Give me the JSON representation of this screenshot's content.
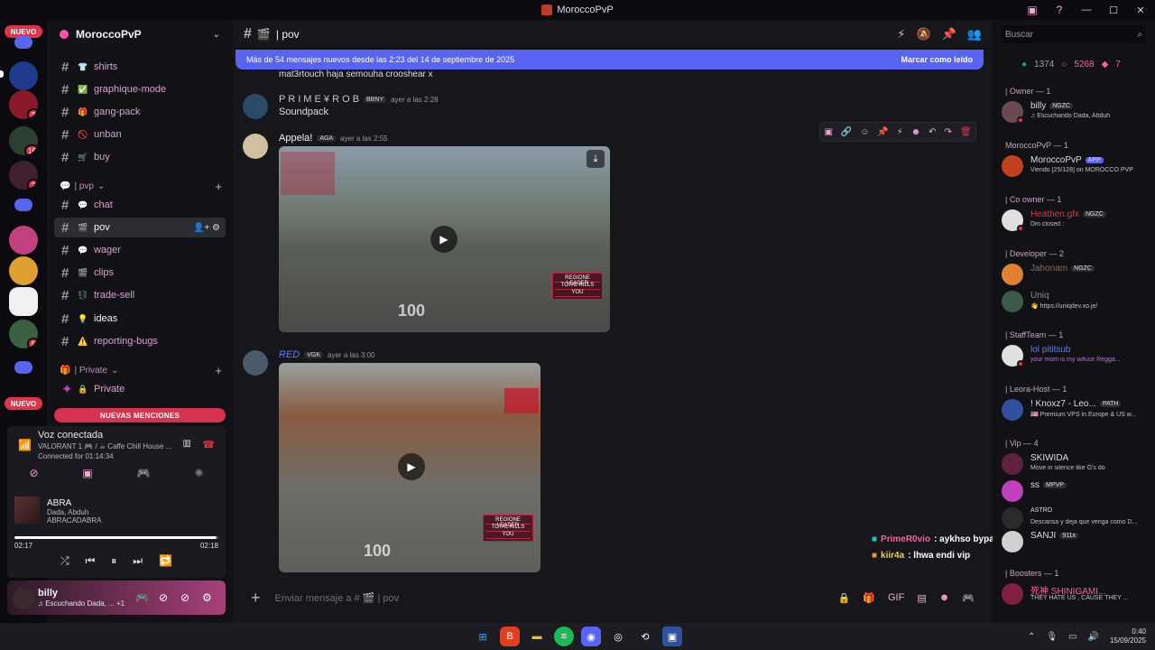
{
  "window": {
    "title": "MoroccoPvP"
  },
  "server": {
    "name": "MoroccoPvP"
  },
  "servers": {
    "new_label": "NUEVO",
    "badges": [
      "3",
      "16",
      "2",
      "5"
    ]
  },
  "channels": {
    "items": [
      {
        "emoji": "👕",
        "name": "shirts"
      },
      {
        "emoji": "✅",
        "name": "graphique-mode"
      },
      {
        "emoji": "🎁",
        "name": "gang-pack"
      },
      {
        "emoji": "🚫",
        "name": "unban"
      },
      {
        "emoji": "🛒",
        "name": "buy"
      }
    ],
    "cat_pvp": "| pvp",
    "pvp_items": [
      {
        "emoji": "💬",
        "name": "chat"
      },
      {
        "emoji": "🎬",
        "name": "pov"
      },
      {
        "emoji": "💬",
        "name": "wager"
      },
      {
        "emoji": "🎬",
        "name": "clips"
      },
      {
        "emoji": "💱",
        "name": "trade-sell"
      },
      {
        "emoji": "💡",
        "name": "ideas"
      },
      {
        "emoji": "⚠️",
        "name": "reporting-bugs"
      }
    ],
    "cat_private": "| Private",
    "private_item": {
      "emoji": "🔒",
      "name": "Private"
    },
    "new_mentions": "NUEVAS MENCIONES"
  },
  "voice": {
    "title": "Voz conectada",
    "sub": "VALORANT 1 🎮 / ☕ Caffe Chill House ...",
    "connected": "Connected for 01:14:34"
  },
  "song": {
    "title": "ABRA",
    "artist": "Dada, Abduh",
    "album": "ABRACADABRA",
    "elapsed": "02:17",
    "total": "02:18",
    "progress": 0.99
  },
  "user": {
    "name": "billy",
    "status": "♫ Escuchando Dada, ...",
    "extra": "+1"
  },
  "chat": {
    "channel_name": "pov",
    "new_banner": "Más de 54 mensajes nuevos desde las 2:23 del 14 de septiembre de 2025",
    "mark_read": "Marcar como leído",
    "prev_text": "mat3rtouch hajа semouha crooshear x",
    "messages": [
      {
        "name": "P R I M E ¥ R O B",
        "tag": "BBNY",
        "time": "ayer a las 2:28",
        "text": "Soundpack"
      },
      {
        "name": "Appela!",
        "tag": "AGA",
        "time": "ayer a las 2:55",
        "text": ""
      },
      {
        "name": "RED",
        "tag": "VGK",
        "time": "ayer a las 3:00",
        "text": ""
      }
    ],
    "overlay": [
      {
        "name": "PrimeR0vio",
        "text": ": aykhso bypass"
      },
      {
        "name": "kiir4a",
        "text": ": lhwa endi vip"
      }
    ],
    "placeholder": "Enviar mensaje a # 🎬 | pov",
    "hud": [
      "REGIONE LEADER",
      "TOTAL KILLS",
      "YOU"
    ],
    "hud_value": "100"
  },
  "members": {
    "search": "Buscar",
    "online": "1374",
    "members": "5268",
    "boost": "7",
    "groups": [
      {
        "cat": "| Owner — 1",
        "list": [
          {
            "name": "billy",
            "tag": "NGZC",
            "status": "♫ Escuchando Dada, Abduh",
            "color": "#ffffff"
          }
        ]
      },
      {
        "cat": "MoroccoPvP — 1",
        "list": [
          {
            "name": "MoroccoPvP",
            "tag": "APP",
            "status": "Viendo [25/128] on MOROCCO PVP",
            "color": "#ffffff"
          }
        ]
      },
      {
        "cat": "| Co owner — 1",
        "list": [
          {
            "name": "Heathen.gfx",
            "tag": "NGZC",
            "status": "Dm closed :",
            "color": "#e0344b"
          }
        ]
      },
      {
        "cat": "| Developer — 2",
        "list": [
          {
            "name": "Jahonam",
            "tag": "NGZC",
            "status": "",
            "color": "#8a6a5a"
          },
          {
            "name": "Uniq",
            "tag": "",
            "status": "👋 https://uniqdev.xo.je/",
            "color": "#7a8a9a"
          }
        ]
      },
      {
        "cat": "| StaffTeam — 1",
        "list": [
          {
            "name": "lol pititsub",
            "tag": "",
            "status": "your mom is my wifuce Regga...",
            "color": "#5b7cff"
          }
        ]
      },
      {
        "cat": "| Leora-Host — 1",
        "list": [
          {
            "name": "! Knoxz7 - Leo...",
            "tag": "PATH",
            "status": "🇺🇸 Premium VPS in Europe & US w...",
            "color": "#ffffff"
          }
        ]
      },
      {
        "cat": "| Vip — 4",
        "list": [
          {
            "name": "SKIWIDA",
            "tag": "",
            "status": "Move in silence like G's do",
            "color": "#ffffff"
          },
          {
            "name": "ss",
            "tag": "MPVP",
            "status": "",
            "color": "#ffffff"
          },
          {
            "name": "ASTRO",
            "tag": "",
            "status": "Descansa y deja que venga como D...",
            "color": "#ffffff"
          },
          {
            "name": "SANJI",
            "tag": "911x",
            "status": "",
            "color": "#ffffff"
          }
        ]
      },
      {
        "cat": "| Boosters — 1",
        "list": [
          {
            "name": "死神 SHINIGAMI...",
            "tag": "",
            "status": "THEY HATE US , CAUSE THEY ...",
            "color": "#ff5fa8"
          }
        ]
      }
    ]
  },
  "taskbar": {
    "time": "0:40",
    "date": "15/09/2025"
  },
  "colors": {
    "accent": "#5865f2",
    "pink": "#f4a6d8",
    "red": "#e0344b"
  }
}
